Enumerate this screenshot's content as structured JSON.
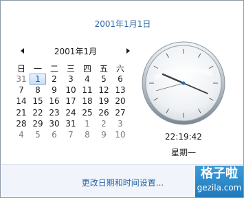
{
  "header": {
    "full_date": "2001年1月1日"
  },
  "calendar": {
    "month_label": "2001年1月",
    "weekdays": [
      "日",
      "一",
      "二",
      "三",
      "四",
      "五",
      "六"
    ],
    "weeks": [
      [
        "31",
        "1",
        "2",
        "3",
        "4",
        "5",
        "6"
      ],
      [
        "7",
        "8",
        "9",
        "10",
        "11",
        "12",
        "13"
      ],
      [
        "14",
        "15",
        "16",
        "17",
        "18",
        "19",
        "20"
      ],
      [
        "21",
        "22",
        "23",
        "24",
        "25",
        "26",
        "27"
      ],
      [
        "28",
        "29",
        "30",
        "31",
        "1",
        "2",
        "3"
      ],
      [
        "4",
        "5",
        "6",
        "7",
        "8",
        "9",
        "10"
      ]
    ],
    "prev_icon": "triangle-left-icon",
    "next_icon": "triangle-right-icon"
  },
  "clock": {
    "time": "22:19:42",
    "weekday": "星期一"
  },
  "footer": {
    "settings_link": "更改日期和时间设置..."
  },
  "watermark": {
    "top": "格子啦",
    "bottom": "gezila.com"
  },
  "colors": {
    "link": "#2b66a8",
    "selected_border": "#7da2ce",
    "footer_bg": "#f1f5fb",
    "watermark": "#2a87c8"
  }
}
